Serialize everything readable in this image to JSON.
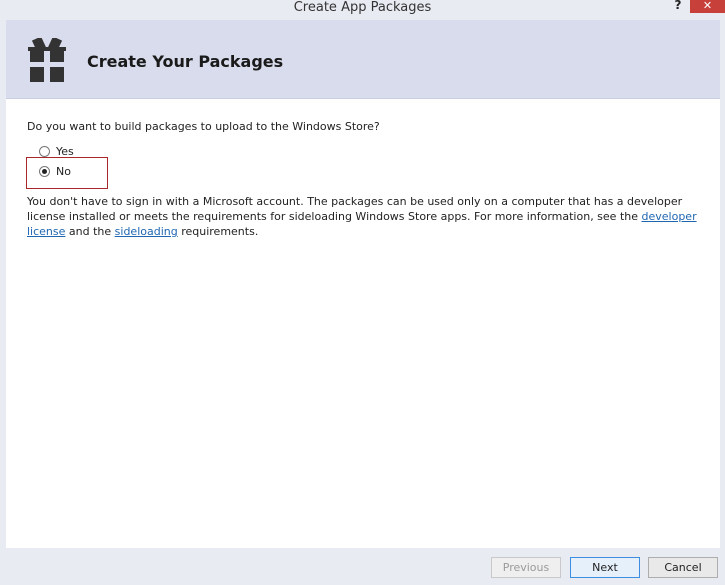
{
  "window": {
    "title": "Create App Packages",
    "help_label": "?",
    "close_label": "✕"
  },
  "header": {
    "title": "Create Your Packages",
    "icon": "gift-icon"
  },
  "content": {
    "question": "Do you want to build packages to upload to the Windows Store?",
    "options": [
      {
        "label": "Yes",
        "selected": false
      },
      {
        "label": "No",
        "selected": true
      }
    ],
    "info_prefix": "You don't have to sign in with a Microsoft account. The packages can be used only on a computer that has a developer license installed or meets the requirements for sideloading Windows Store apps. For more information, see the ",
    "link_developer_license": "developer license",
    "info_and": " and the ",
    "link_sideloading": "sideloading",
    "info_suffix": " requirements."
  },
  "footer": {
    "previous_label": "Previous",
    "next_label": "Next",
    "cancel_label": "Cancel"
  },
  "colors": {
    "header_bg": "#d8dcec",
    "highlight": "#a9262b",
    "link": "#1f66b1",
    "close_bg": "#c7403a"
  }
}
